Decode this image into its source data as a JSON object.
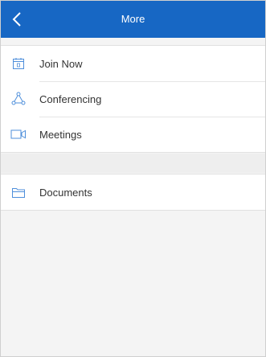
{
  "header": {
    "title": "More",
    "back_icon": "chevron-left-icon"
  },
  "menu": {
    "group1": [
      {
        "label": "Join Now",
        "icon": "calendar-icon"
      },
      {
        "label": "Conferencing",
        "icon": "network-icon"
      },
      {
        "label": "Meetings",
        "icon": "video-camera-icon"
      }
    ],
    "group2": [
      {
        "label": "Documents",
        "icon": "folder-icon"
      }
    ]
  },
  "colors": {
    "header_bg": "#1767c4",
    "icon_blue": "#4f8fdb"
  }
}
